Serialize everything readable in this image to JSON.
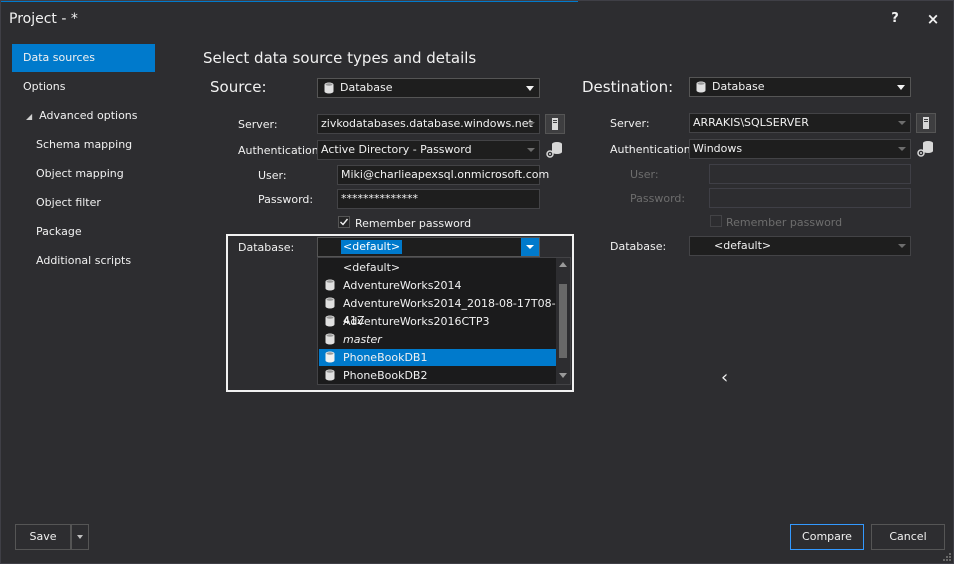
{
  "window": {
    "title": "Project - *",
    "help_label": "?",
    "close_label": "×"
  },
  "sidebar": {
    "items": [
      {
        "label": "Data sources",
        "active": true
      },
      {
        "label": "Options"
      },
      {
        "label": "Advanced options",
        "expanded": true
      },
      {
        "label": "Schema mapping"
      },
      {
        "label": "Object mapping"
      },
      {
        "label": "Object filter"
      },
      {
        "label": "Package"
      },
      {
        "label": "Additional scripts"
      }
    ],
    "expand_glyph": "◢"
  },
  "main": {
    "section_title": "Select data source types and details"
  },
  "source": {
    "label": "Source:",
    "type": "Database",
    "server_label": "Server:",
    "server": "zivkodatabases.database.windows.net",
    "auth_label": "Authentication:",
    "auth": "Active Directory - Password",
    "user_label": "User:",
    "user": "Miki@charlieapexsql.onmicrosoft.com",
    "password_label": "Password:",
    "password": "**************",
    "remember_label": "Remember password",
    "remember_checked": true,
    "database_label": "Database:",
    "database": "<default>",
    "database_options": [
      {
        "label": "<default>",
        "icon": ""
      },
      {
        "label": "AdventureWorks2014",
        "icon": "database-icon"
      },
      {
        "label": "AdventureWorks2014_2018-08-17T08-41Z",
        "icon": "database-icon"
      },
      {
        "label": "AdventureWorks2016CTP3",
        "icon": "database-icon"
      },
      {
        "label": "master",
        "icon": "database-icon",
        "italic": true
      },
      {
        "label": "PhoneBookDB1",
        "icon": "database-icon",
        "selected": true
      },
      {
        "label": "PhoneBookDB2",
        "icon": "database-icon"
      }
    ]
  },
  "destination": {
    "label": "Destination:",
    "type": "Database",
    "server_label": "Server:",
    "server": "ARRAKIS\\SQLSERVER",
    "auth_label": "Authentication:",
    "auth": "Windows",
    "user_label": "User:",
    "user": "",
    "password_label": "Password:",
    "password": "",
    "remember_label": "Remember password",
    "remember_checked": false,
    "database_label": "Database:",
    "database": "<default>"
  },
  "nav": {
    "back_glyph": "‹"
  },
  "footer": {
    "save_label": "Save",
    "compare_label": "Compare",
    "cancel_label": "Cancel"
  },
  "colors": {
    "accent": "#007acc",
    "background": "#2d2d30",
    "input_bg": "#1e1e1e"
  }
}
